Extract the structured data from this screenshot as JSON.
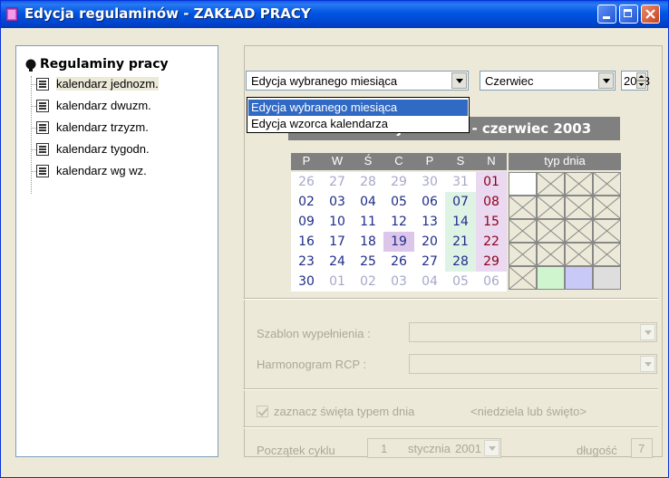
{
  "window": {
    "title": "Edycja regulaminów - ZAKŁAD PRACY"
  },
  "tree": {
    "root": "Regulaminy pracy",
    "items": [
      {
        "label": "kalendarz jednozm."
      },
      {
        "label": "kalendarz dwuzm."
      },
      {
        "label": "kalendarz trzyzm."
      },
      {
        "label": "kalendarz tygodn."
      },
      {
        "label": "kalendarz wg wz."
      }
    ]
  },
  "toolbar": {
    "mode_value": "Edycja wybranego miesiąca",
    "month_value": "Czerwiec",
    "year_value": "2003"
  },
  "dropdown": {
    "options": [
      "Edycja wybranego miesiąca",
      "Edycja wzorca kalendarza"
    ]
  },
  "calendar": {
    "title_left": "kalendarz jednozm.",
    "title_right": "- czerwiec 2003",
    "weekdays": [
      "P",
      "W",
      "Ś",
      "C",
      "P",
      "S",
      "N"
    ],
    "day_type_header": "typ dnia",
    "weeks": [
      [
        "26",
        "27",
        "28",
        "29",
        "30",
        "31",
        "01"
      ],
      [
        "02",
        "03",
        "04",
        "05",
        "06",
        "07",
        "08"
      ],
      [
        "09",
        "10",
        "11",
        "12",
        "13",
        "14",
        "15"
      ],
      [
        "16",
        "17",
        "18",
        "19",
        "20",
        "21",
        "22"
      ],
      [
        "23",
        "24",
        "25",
        "26",
        "27",
        "28",
        "29"
      ],
      [
        "30",
        "01",
        "02",
        "03",
        "04",
        "05",
        "06"
      ]
    ],
    "colors": {
      "saturday_bg": "#dff3e4",
      "sunday_bg": "#ead9f0",
      "holiday_bg": "#dcc7ea",
      "type_green": "#cff5cf",
      "type_blue": "#c9c9f7",
      "type_gray": "#dedede"
    }
  },
  "form": {
    "template_label": "Szablon wypełnienia :",
    "schedule_label": "Harmonogram RCP :",
    "holiday_checkbox_label": "zaznacz święta typem dnia",
    "holiday_hint": "<niedziela lub święto>",
    "cycle_start_label": "Początek cyklu",
    "cycle_day": "1",
    "cycle_month": "stycznia",
    "cycle_year": "2001",
    "length_label": "długość",
    "length_value": "7"
  }
}
